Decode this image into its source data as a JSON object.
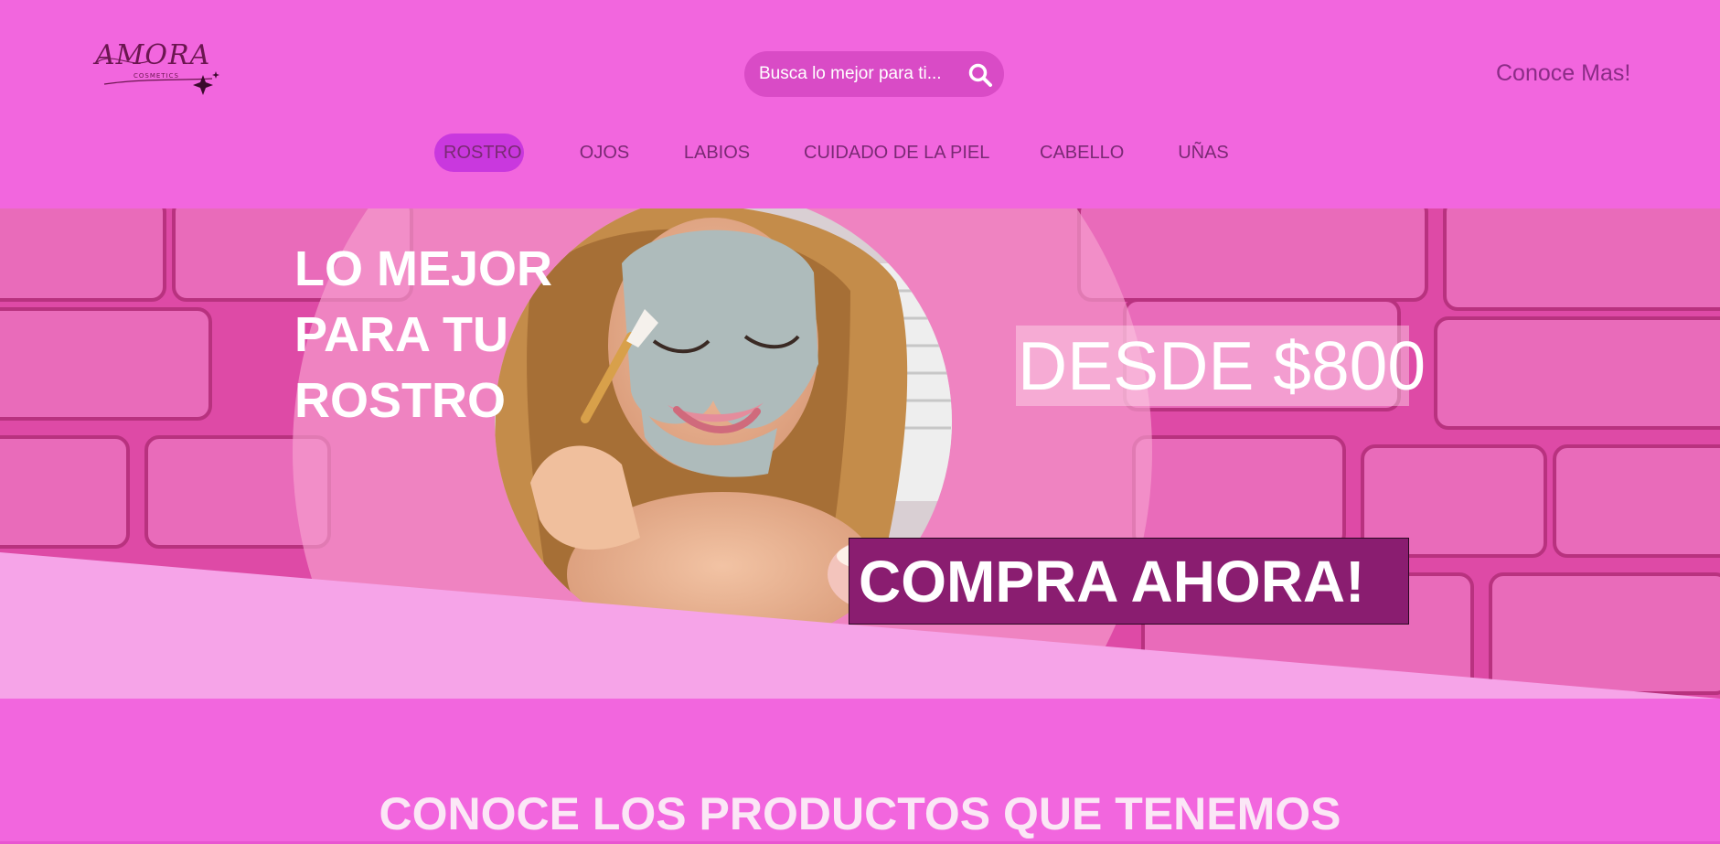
{
  "header": {
    "logo": {
      "text": "AMORA",
      "subtext": "COSMETICS"
    },
    "search": {
      "placeholder": "Busca lo mejor para ti...",
      "icon": "search-icon"
    },
    "more_link": "Conoce Mas!",
    "nav": [
      {
        "label": "ROSTRO",
        "active": true
      },
      {
        "label": "OJOS",
        "active": false
      },
      {
        "label": "LABIOS",
        "active": false
      },
      {
        "label": "CUIDADO DE LA PIEL",
        "active": false
      },
      {
        "label": "CABELLO",
        "active": false
      },
      {
        "label": "UÑAS",
        "active": false
      }
    ]
  },
  "hero": {
    "title_lines": [
      "LO MEJOR",
      "PARA TU",
      "ROSTRO"
    ],
    "price": "DESDE $800",
    "cta": "COMPRA AHORA!"
  },
  "products": {
    "heading": "CONOCE LOS PRODUCTOS QUE TENEMOS"
  },
  "colors": {
    "brand_pink": "#f266de",
    "active_nav": "#c938de",
    "search_bg": "#d94bc6",
    "cta_bg": "#8a1d70"
  }
}
